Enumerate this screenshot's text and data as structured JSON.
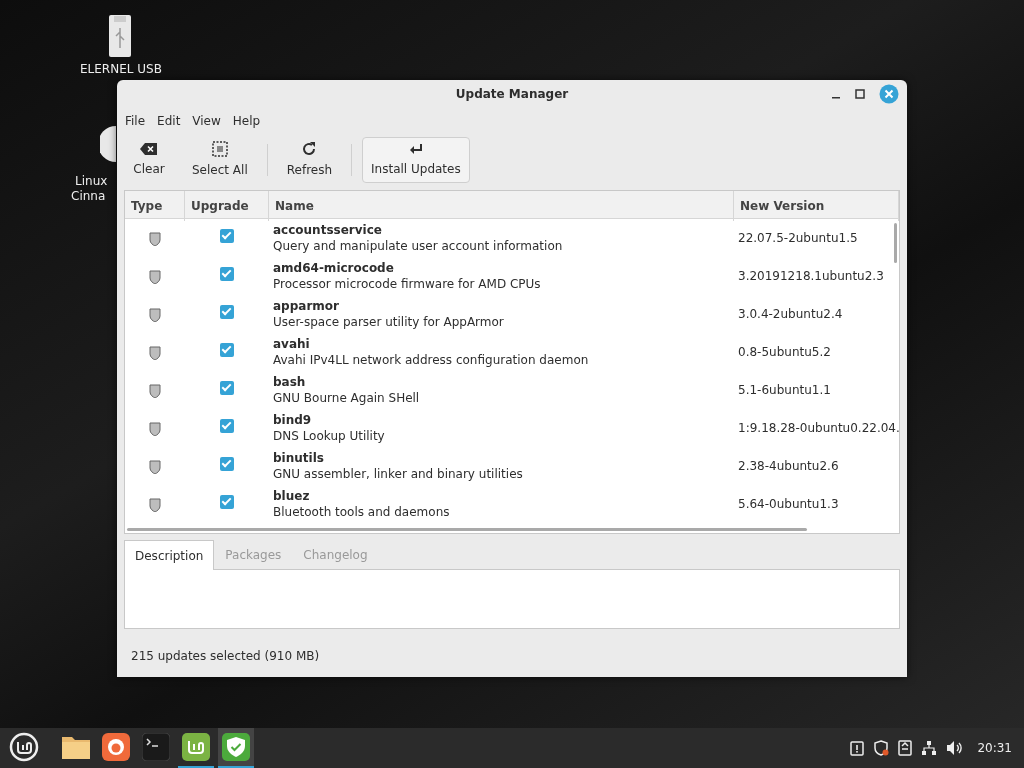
{
  "desktop_icons": [
    {
      "kind": "usb",
      "lines": [
        "ELERNEL USB"
      ]
    },
    {
      "kind": "disc",
      "lines": [
        "Linux",
        "Cinna"
      ]
    }
  ],
  "window": {
    "title": "Update Manager",
    "menu": [
      "File",
      "Edit",
      "View",
      "Help"
    ],
    "toolbar": [
      {
        "kind": "clear",
        "label": "Clear",
        "hovered": false
      },
      {
        "kind": "select-all",
        "label": "Select All",
        "hovered": false
      },
      {
        "kind": "refresh",
        "label": "Refresh",
        "hovered": false
      },
      {
        "kind": "install",
        "label": "Install Updates",
        "hovered": true
      }
    ],
    "table": {
      "columns": [
        "Type",
        "Upgrade",
        "Name",
        "New Version"
      ],
      "rows": [
        {
          "name": "accountsservice",
          "description": "Query and manipulate user account information",
          "new_version": "22.07.5-2ubuntu1.5",
          "upgrade": true
        },
        {
          "name": "amd64-microcode",
          "description": "Processor microcode firmware for AMD CPUs",
          "new_version": "3.20191218.1ubuntu2.3",
          "upgrade": true
        },
        {
          "name": "apparmor",
          "description": "User-space parser utility for AppArmor",
          "new_version": "3.0.4-2ubuntu2.4",
          "upgrade": true
        },
        {
          "name": "avahi",
          "description": "Avahi IPv4LL network address configuration daemon",
          "new_version": "0.8-5ubuntu5.2",
          "upgrade": true
        },
        {
          "name": "bash",
          "description": "GNU Bourne Again SHell",
          "new_version": "5.1-6ubuntu1.1",
          "upgrade": true
        },
        {
          "name": "bind9",
          "description": "DNS Lookup Utility",
          "new_version": "1:9.18.28-0ubuntu0.22.04.",
          "upgrade": true
        },
        {
          "name": "binutils",
          "description": "GNU assembler, linker and binary utilities",
          "new_version": "2.38-4ubuntu2.6",
          "upgrade": true
        },
        {
          "name": "bluez",
          "description": "Bluetooth tools and daemons",
          "new_version": "5.64-0ubuntu1.3",
          "upgrade": true
        }
      ]
    },
    "tabs": [
      {
        "label": "Description",
        "selected": true
      },
      {
        "label": "Packages",
        "selected": false
      },
      {
        "label": "Changelog",
        "selected": false
      }
    ],
    "status": "215 updates selected (910 MB)"
  },
  "taskbar": {
    "apps": [
      {
        "kind": "menu",
        "running": false,
        "focused": false
      },
      {
        "kind": "files",
        "running": false,
        "focused": false
      },
      {
        "kind": "firefox",
        "running": false,
        "focused": false
      },
      {
        "kind": "terminal",
        "running": false,
        "focused": false
      },
      {
        "kind": "mintupdate",
        "running": true,
        "focused": false
      },
      {
        "kind": "shield",
        "running": true,
        "focused": true
      }
    ],
    "clock": "20:31"
  }
}
